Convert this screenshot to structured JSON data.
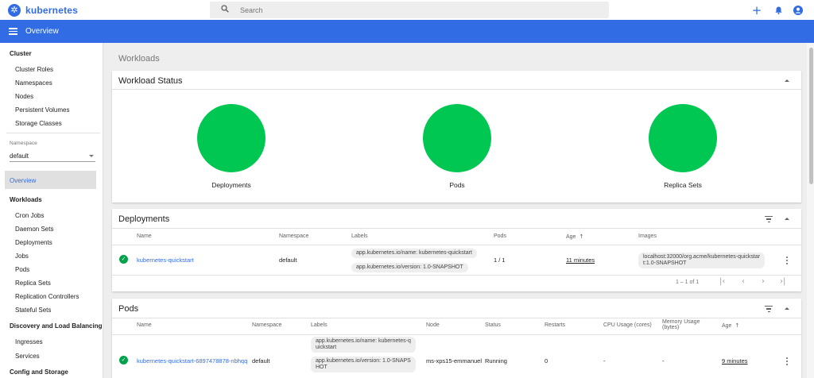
{
  "app": {
    "name": "kubernetes"
  },
  "search": {
    "placeholder": "Search"
  },
  "toolbar": {
    "title": "Overview"
  },
  "sidebar": {
    "cluster_heading": "Cluster",
    "cluster_items": [
      "Cluster Roles",
      "Namespaces",
      "Nodes",
      "Persistent Volumes",
      "Storage Classes"
    ],
    "namespace_label": "Namespace",
    "namespace_value": "default",
    "active_item": "Overview",
    "workloads_heading": "Workloads",
    "workload_items": [
      "Cron Jobs",
      "Daemon Sets",
      "Deployments",
      "Jobs",
      "Pods",
      "Replica Sets",
      "Replication Controllers",
      "Stateful Sets"
    ],
    "discovery_heading": "Discovery and Load Balancing",
    "discovery_items": [
      "Ingresses",
      "Services"
    ],
    "config_heading": "Config and Storage"
  },
  "main": {
    "title": "Workloads",
    "status_card": {
      "title": "Workload Status",
      "items": [
        {
          "label": "Deployments",
          "color": "#00c752"
        },
        {
          "label": "Pods",
          "color": "#00c752"
        },
        {
          "label": "Replica Sets",
          "color": "#00c752"
        }
      ]
    },
    "deployments": {
      "title": "Deployments",
      "columns": [
        "Name",
        "Namespace",
        "Labels",
        "Pods",
        "Age",
        "Images"
      ],
      "sort_icon": "arrow-up-icon",
      "rows": [
        {
          "name": "kubernetes-quickstart",
          "namespace": "default",
          "labels": [
            "app.kubernetes.io/name: kubernetes-quickstart",
            "app.kubernetes.io/version: 1.0-SNAPSHOT"
          ],
          "pods": "1 / 1",
          "age": "11 minutes",
          "image_line1": "localhost:32000/org.acme/kubernetes-quickstar",
          "image_line2": "t:1.0-SNAPSHOT"
        }
      ],
      "pagination": "1 – 1 of 1"
    },
    "pods": {
      "title": "Pods",
      "columns": [
        "Name",
        "Namespace",
        "Labels",
        "Node",
        "Status",
        "Restarts",
        "CPU Usage (cores)",
        "Memory Usage",
        "(bytes)",
        "Age"
      ],
      "rows": [
        {
          "name": "kubernetes-quickstart-6897478878-nbhqq",
          "namespace": "default",
          "label1_line1": "app.kubernetes.io/name: kubernetes-q",
          "label1_line2": "uickstart",
          "label2_line1": "app.kubernetes.io/version: 1.0-SNAPS",
          "label2_line2": "HOT",
          "node": "ms-xps15-emmanuel",
          "status": "Running",
          "restarts": "0",
          "cpu": "-",
          "memory": "-",
          "age": "9 minutes"
        }
      ]
    }
  }
}
